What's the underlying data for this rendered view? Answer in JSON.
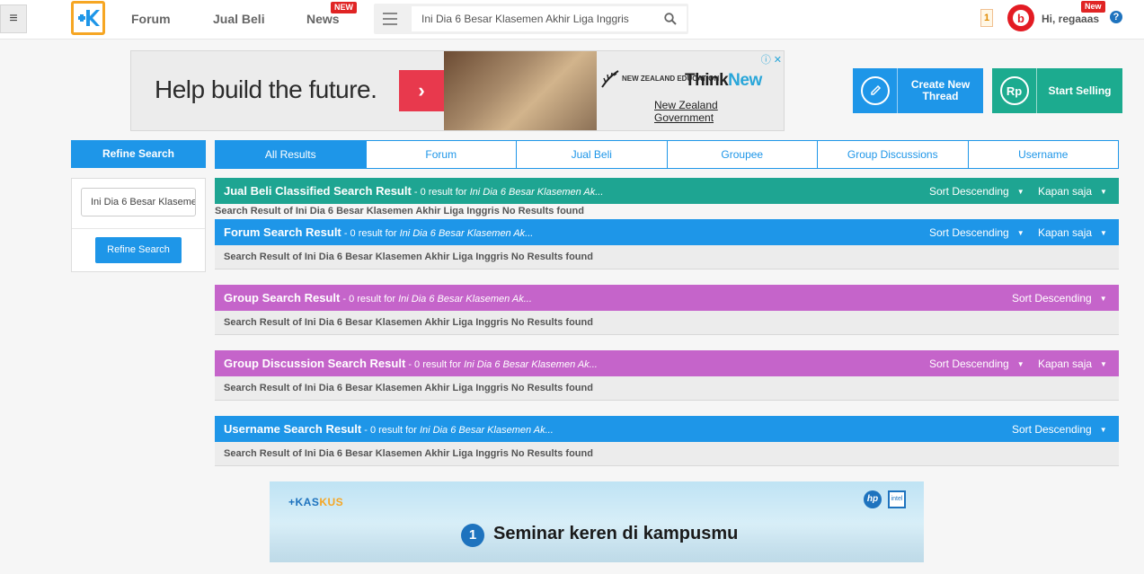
{
  "nav": {
    "menu_icon": "hamburger-icon",
    "logo": "kaskus-logo",
    "links": [
      {
        "label": "Forum"
      },
      {
        "label": "Jual Beli"
      },
      {
        "label": "News",
        "badge": "NEW"
      }
    ],
    "search_value": "Ini Dia 6 Besar Klasemen Akhir Liga Inggris",
    "notification_count": "1",
    "greeting": "Hi, regaaas",
    "user_badge": "New",
    "help": "?"
  },
  "ad_top": {
    "headline": "Help build the future.",
    "arrow": "›",
    "brand_edu": "NEW ZEALAND EDUCATION",
    "brand_think": "Think",
    "brand_new": "New",
    "brand_gov": "New Zealand Government",
    "close": "ⓘ ✕"
  },
  "actions": {
    "create_thread": "Create New Thread",
    "start_selling": "Start Selling",
    "rp_icon": "Rp"
  },
  "sidebar": {
    "header": "Refine Search",
    "input_value": "Ini Dia 6 Besar Klasemen",
    "button": "Refine Search"
  },
  "tabs": [
    {
      "label": "All Results",
      "active": true
    },
    {
      "label": "Forum"
    },
    {
      "label": "Jual Beli"
    },
    {
      "label": "Groupee"
    },
    {
      "label": "Group Discussions"
    },
    {
      "label": "Username"
    }
  ],
  "query_short": "Ini Dia 6 Besar Klasemen Ak...",
  "no_results_text": "Search Result of Ini Dia 6 Besar Klasemen Akhir Liga Inggris No Results found",
  "sections": [
    {
      "title": "Jual Beli Classified Search Result",
      "count": " - 0 result for ",
      "sort": "Sort Descending",
      "time": "Kapan saja",
      "color": "#1ea592"
    },
    {
      "title": "Forum Search Result",
      "count": " - 0 result for ",
      "sort": "Sort Descending",
      "time": "Kapan saja",
      "color": "#1e96e8"
    },
    {
      "title": "Group Search Result",
      "count": " - 0 result for ",
      "sort": "Sort Descending",
      "color": "#c564ca"
    },
    {
      "title": "Group Discussion Search Result",
      "count": " - 0 result for ",
      "sort": "Sort Descending",
      "time": "Kapan saja",
      "color": "#c564ca"
    },
    {
      "title": "Username Search Result",
      "count": " - 0 result for ",
      "sort": "Sort Descending",
      "color": "#1e96e8"
    }
  ],
  "ad_bottom": {
    "brand_a": "+KAS",
    "brand_b": "KUS",
    "hp": "hp",
    "intel": "intel",
    "number": "1",
    "text": "Seminar keren di kampusmu"
  }
}
